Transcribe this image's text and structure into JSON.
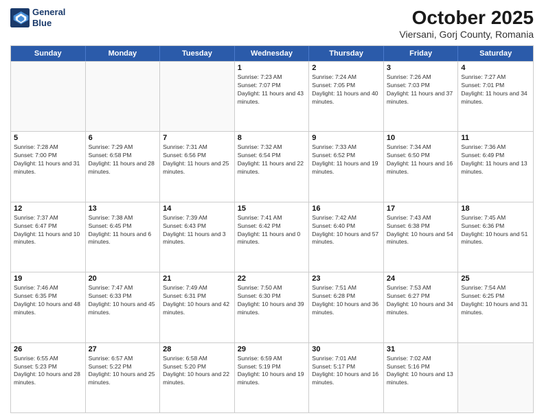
{
  "header": {
    "logo_line1": "General",
    "logo_line2": "Blue",
    "month_title": "October 2025",
    "subtitle": "Viersani, Gorj County, Romania"
  },
  "days_of_week": [
    "Sunday",
    "Monday",
    "Tuesday",
    "Wednesday",
    "Thursday",
    "Friday",
    "Saturday"
  ],
  "weeks": [
    [
      {
        "day": "",
        "info": ""
      },
      {
        "day": "",
        "info": ""
      },
      {
        "day": "",
        "info": ""
      },
      {
        "day": "1",
        "info": "Sunrise: 7:23 AM\nSunset: 7:07 PM\nDaylight: 11 hours and 43 minutes."
      },
      {
        "day": "2",
        "info": "Sunrise: 7:24 AM\nSunset: 7:05 PM\nDaylight: 11 hours and 40 minutes."
      },
      {
        "day": "3",
        "info": "Sunrise: 7:26 AM\nSunset: 7:03 PM\nDaylight: 11 hours and 37 minutes."
      },
      {
        "day": "4",
        "info": "Sunrise: 7:27 AM\nSunset: 7:01 PM\nDaylight: 11 hours and 34 minutes."
      }
    ],
    [
      {
        "day": "5",
        "info": "Sunrise: 7:28 AM\nSunset: 7:00 PM\nDaylight: 11 hours and 31 minutes."
      },
      {
        "day": "6",
        "info": "Sunrise: 7:29 AM\nSunset: 6:58 PM\nDaylight: 11 hours and 28 minutes."
      },
      {
        "day": "7",
        "info": "Sunrise: 7:31 AM\nSunset: 6:56 PM\nDaylight: 11 hours and 25 minutes."
      },
      {
        "day": "8",
        "info": "Sunrise: 7:32 AM\nSunset: 6:54 PM\nDaylight: 11 hours and 22 minutes."
      },
      {
        "day": "9",
        "info": "Sunrise: 7:33 AM\nSunset: 6:52 PM\nDaylight: 11 hours and 19 minutes."
      },
      {
        "day": "10",
        "info": "Sunrise: 7:34 AM\nSunset: 6:50 PM\nDaylight: 11 hours and 16 minutes."
      },
      {
        "day": "11",
        "info": "Sunrise: 7:36 AM\nSunset: 6:49 PM\nDaylight: 11 hours and 13 minutes."
      }
    ],
    [
      {
        "day": "12",
        "info": "Sunrise: 7:37 AM\nSunset: 6:47 PM\nDaylight: 11 hours and 10 minutes."
      },
      {
        "day": "13",
        "info": "Sunrise: 7:38 AM\nSunset: 6:45 PM\nDaylight: 11 hours and 6 minutes."
      },
      {
        "day": "14",
        "info": "Sunrise: 7:39 AM\nSunset: 6:43 PM\nDaylight: 11 hours and 3 minutes."
      },
      {
        "day": "15",
        "info": "Sunrise: 7:41 AM\nSunset: 6:42 PM\nDaylight: 11 hours and 0 minutes."
      },
      {
        "day": "16",
        "info": "Sunrise: 7:42 AM\nSunset: 6:40 PM\nDaylight: 10 hours and 57 minutes."
      },
      {
        "day": "17",
        "info": "Sunrise: 7:43 AM\nSunset: 6:38 PM\nDaylight: 10 hours and 54 minutes."
      },
      {
        "day": "18",
        "info": "Sunrise: 7:45 AM\nSunset: 6:36 PM\nDaylight: 10 hours and 51 minutes."
      }
    ],
    [
      {
        "day": "19",
        "info": "Sunrise: 7:46 AM\nSunset: 6:35 PM\nDaylight: 10 hours and 48 minutes."
      },
      {
        "day": "20",
        "info": "Sunrise: 7:47 AM\nSunset: 6:33 PM\nDaylight: 10 hours and 45 minutes."
      },
      {
        "day": "21",
        "info": "Sunrise: 7:49 AM\nSunset: 6:31 PM\nDaylight: 10 hours and 42 minutes."
      },
      {
        "day": "22",
        "info": "Sunrise: 7:50 AM\nSunset: 6:30 PM\nDaylight: 10 hours and 39 minutes."
      },
      {
        "day": "23",
        "info": "Sunrise: 7:51 AM\nSunset: 6:28 PM\nDaylight: 10 hours and 36 minutes."
      },
      {
        "day": "24",
        "info": "Sunrise: 7:53 AM\nSunset: 6:27 PM\nDaylight: 10 hours and 34 minutes."
      },
      {
        "day": "25",
        "info": "Sunrise: 7:54 AM\nSunset: 6:25 PM\nDaylight: 10 hours and 31 minutes."
      }
    ],
    [
      {
        "day": "26",
        "info": "Sunrise: 6:55 AM\nSunset: 5:23 PM\nDaylight: 10 hours and 28 minutes."
      },
      {
        "day": "27",
        "info": "Sunrise: 6:57 AM\nSunset: 5:22 PM\nDaylight: 10 hours and 25 minutes."
      },
      {
        "day": "28",
        "info": "Sunrise: 6:58 AM\nSunset: 5:20 PM\nDaylight: 10 hours and 22 minutes."
      },
      {
        "day": "29",
        "info": "Sunrise: 6:59 AM\nSunset: 5:19 PM\nDaylight: 10 hours and 19 minutes."
      },
      {
        "day": "30",
        "info": "Sunrise: 7:01 AM\nSunset: 5:17 PM\nDaylight: 10 hours and 16 minutes."
      },
      {
        "day": "31",
        "info": "Sunrise: 7:02 AM\nSunset: 5:16 PM\nDaylight: 10 hours and 13 minutes."
      },
      {
        "day": "",
        "info": ""
      }
    ]
  ]
}
